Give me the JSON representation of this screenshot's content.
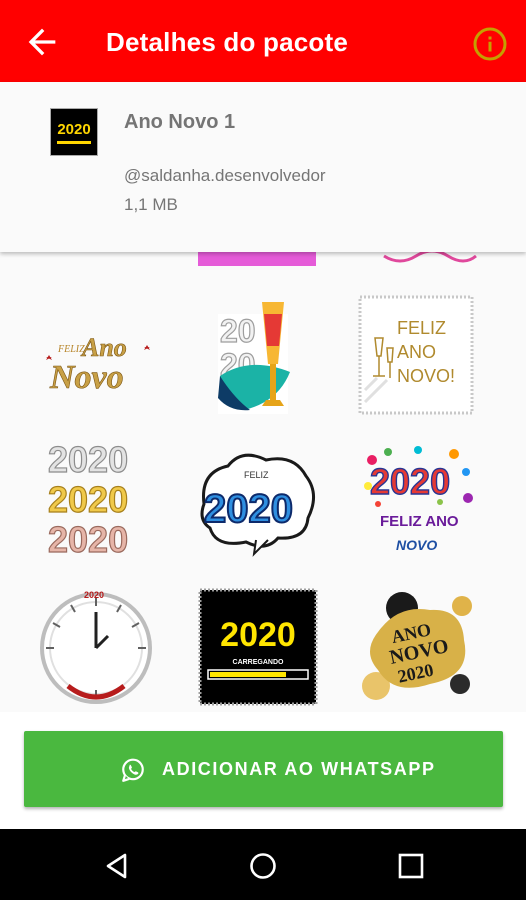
{
  "app_bar": {
    "title": "Detalhes do pacote",
    "back_icon": "arrow-back-icon",
    "info_icon": "info-icon",
    "color": "#ff0000"
  },
  "pack": {
    "tray_text": "2020",
    "name": "Ano Novo 1",
    "author": "@saldanha.desenvolvedor",
    "size": "1,1 MB"
  },
  "stickers": {
    "s1": {
      "small": "FELIZ",
      "big1": "Ano",
      "big2": "Novo"
    },
    "s2": {
      "a": "20",
      "b": "20"
    },
    "s3": {
      "l1": "FELIZ",
      "l2": "ANO",
      "l3": "NOVO!"
    },
    "s4": {
      "r1": "2020",
      "r2": "2020",
      "r3": "2020"
    },
    "s5": {
      "small": "FELIZ",
      "big": "2020"
    },
    "s6": {
      "big": "2020",
      "l2": "FELIZ ANO",
      "l3": "NOVO"
    },
    "s7": {
      "top": "2020"
    },
    "s8": {
      "big": "2020",
      "small": "CARREGANDO"
    },
    "s9": {
      "l1": "ANO",
      "l2": "NOVO",
      "l3": "2020"
    }
  },
  "add_button": {
    "label": "ADICIONAR AO WHATSAPP",
    "icon": "whatsapp-icon",
    "color": "#4ab83f"
  },
  "nav_bar": {
    "back": "nav-back-icon",
    "home": "nav-home-icon",
    "recents": "nav-recents-icon"
  }
}
